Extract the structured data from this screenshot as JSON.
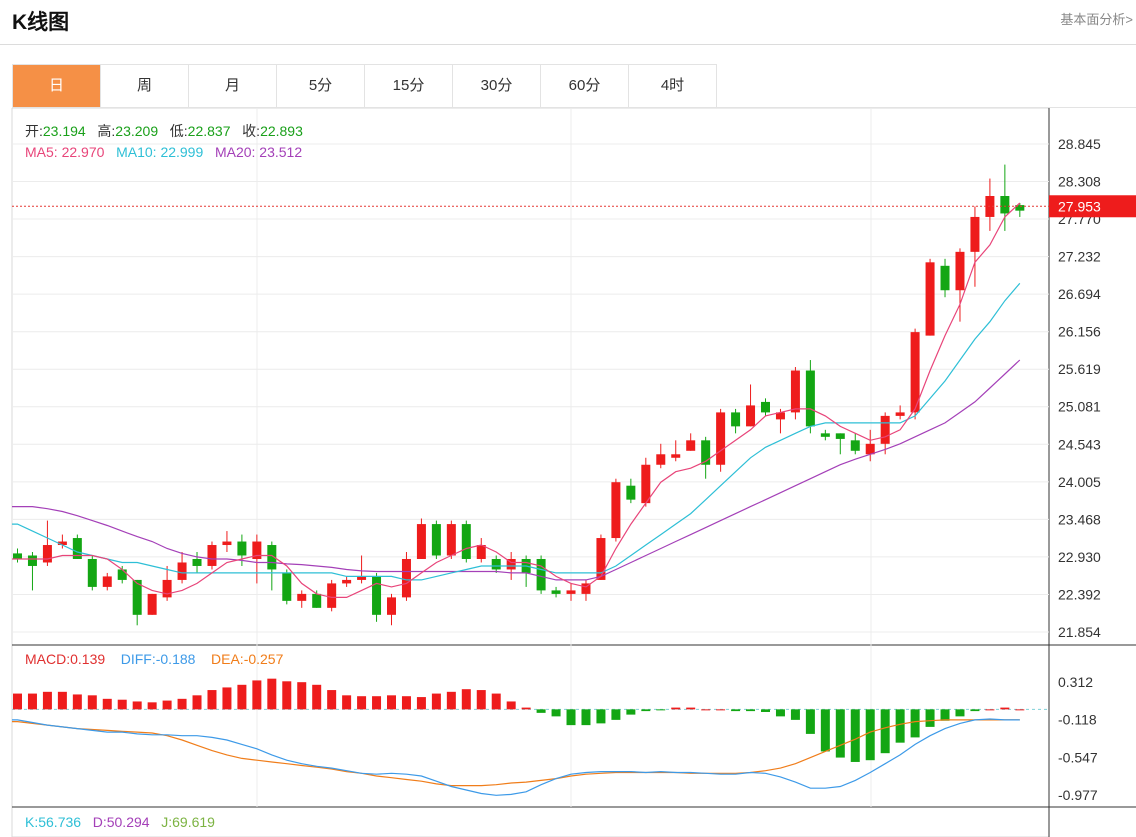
{
  "header": {
    "title": "K线图",
    "more_link": "基本面分析>"
  },
  "tabs": [
    {
      "label": "日",
      "active": true
    },
    {
      "label": "周",
      "active": false
    },
    {
      "label": "月",
      "active": false
    },
    {
      "label": "5分",
      "active": false
    },
    {
      "label": "15分",
      "active": false
    },
    {
      "label": "30分",
      "active": false
    },
    {
      "label": "60分",
      "active": false
    },
    {
      "label": "4时",
      "active": false
    }
  ],
  "ohlc_info": {
    "open_label": "开:",
    "open": "23.194",
    "high_label": "高:",
    "high": "23.209",
    "low_label": "低:",
    "low": "22.837",
    "close_label": "收:",
    "close": "22.893"
  },
  "ma_info": {
    "ma5_label": "MA5:",
    "ma5": "22.970",
    "ma10_label": "MA10:",
    "ma10": "22.999",
    "ma20_label": "MA20:",
    "ma20": "23.512"
  },
  "macd_info": {
    "macd_label": "MACD:",
    "macd": "0.139",
    "diff_label": "DIFF:",
    "diff": "-0.188",
    "dea_label": "DEA:",
    "dea": "-0.257"
  },
  "kdj_info": {
    "k_label": "K:",
    "k": "56.736",
    "d_label": "D:",
    "d": "50.294",
    "j_label": "J:",
    "j": "69.619"
  },
  "colors": {
    "up": "#ee1c1c",
    "down": "#13a613",
    "ma5": "#e8457a",
    "ma10": "#2ebfd6",
    "ma20": "#a440b8",
    "diff": "#3d9ae8",
    "dea": "#f07d1a",
    "accent": "#f59046"
  },
  "chart_data": [
    {
      "type": "candlestick",
      "ylim": [
        21.6,
        29.1
      ],
      "y_ticks": [
        "28.845",
        "28.308",
        "27.770",
        "27.232",
        "26.694",
        "26.156",
        "25.619",
        "25.081",
        "24.543",
        "24.005",
        "23.468",
        "22.930",
        "22.392",
        "21.854"
      ],
      "last_price": "27.953",
      "candles": [
        [
          22.98,
          22.9,
          23.05,
          22.85
        ],
        [
          22.95,
          22.8,
          23.0,
          22.45
        ],
        [
          22.85,
          23.1,
          23.45,
          22.8
        ],
        [
          23.1,
          23.15,
          23.25,
          23.05
        ],
        [
          23.2,
          22.9,
          23.25,
          22.9
        ],
        [
          22.9,
          22.5,
          22.95,
          22.45
        ],
        [
          22.5,
          22.65,
          22.7,
          22.45
        ],
        [
          22.75,
          22.6,
          22.8,
          22.55
        ],
        [
          22.6,
          22.1,
          22.6,
          21.95
        ],
        [
          22.1,
          22.4,
          22.4,
          22.1
        ],
        [
          22.35,
          22.6,
          22.8,
          22.3
        ],
        [
          22.6,
          22.85,
          23.0,
          22.55
        ],
        [
          22.9,
          22.8,
          23.0,
          22.7
        ],
        [
          22.8,
          23.1,
          23.15,
          22.75
        ],
        [
          23.1,
          23.15,
          23.3,
          23.0
        ],
        [
          23.15,
          22.95,
          23.25,
          22.8
        ],
        [
          22.9,
          23.15,
          23.25,
          22.55
        ],
        [
          23.1,
          22.75,
          23.15,
          22.45
        ],
        [
          22.7,
          22.3,
          22.75,
          22.25
        ],
        [
          22.3,
          22.4,
          22.45,
          22.2
        ],
        [
          22.4,
          22.2,
          22.45,
          22.2
        ],
        [
          22.2,
          22.55,
          22.6,
          22.15
        ],
        [
          22.55,
          22.6,
          22.65,
          22.5
        ],
        [
          22.6,
          22.65,
          22.95,
          22.55
        ],
        [
          22.65,
          22.1,
          22.7,
          22.0
        ],
        [
          22.1,
          22.35,
          22.4,
          21.95
        ],
        [
          22.35,
          22.9,
          23.0,
          22.3
        ],
        [
          22.9,
          23.4,
          23.48,
          22.9
        ],
        [
          23.4,
          22.95,
          23.45,
          22.9
        ],
        [
          22.95,
          23.4,
          23.45,
          22.9
        ],
        [
          23.4,
          22.9,
          23.45,
          22.85
        ],
        [
          22.9,
          23.1,
          23.2,
          22.85
        ],
        [
          22.9,
          22.75,
          22.95,
          22.7
        ],
        [
          22.75,
          22.9,
          23.0,
          22.6
        ],
        [
          22.9,
          22.7,
          22.95,
          22.5
        ],
        [
          22.9,
          22.45,
          22.95,
          22.4
        ],
        [
          22.45,
          22.4,
          22.5,
          22.35
        ],
        [
          22.4,
          22.45,
          22.55,
          22.3
        ],
        [
          22.4,
          22.55,
          22.6,
          22.3
        ],
        [
          22.6,
          23.2,
          23.25,
          22.6
        ],
        [
          23.2,
          24.0,
          24.05,
          23.15
        ],
        [
          23.95,
          23.75,
          24.05,
          23.7
        ],
        [
          23.7,
          24.25,
          24.35,
          23.65
        ],
        [
          24.25,
          24.4,
          24.55,
          24.2
        ],
        [
          24.35,
          24.4,
          24.6,
          24.3
        ],
        [
          24.45,
          24.6,
          24.7,
          24.45
        ],
        [
          24.6,
          24.25,
          24.65,
          24.05
        ],
        [
          24.25,
          25.0,
          25.05,
          24.15
        ],
        [
          25.0,
          24.8,
          25.05,
          24.7
        ],
        [
          24.8,
          25.1,
          25.4,
          24.8
        ],
        [
          25.15,
          25.0,
          25.2,
          24.95
        ],
        [
          24.9,
          25.0,
          25.05,
          24.7
        ],
        [
          25.0,
          25.6,
          25.65,
          24.9
        ],
        [
          25.6,
          24.8,
          25.75,
          24.7
        ],
        [
          24.7,
          24.65,
          24.75,
          24.6
        ],
        [
          24.7,
          24.62,
          24.7,
          24.4
        ],
        [
          24.6,
          24.45,
          24.7,
          24.4
        ],
        [
          24.4,
          24.55,
          24.75,
          24.3
        ],
        [
          24.55,
          24.95,
          25.0,
          24.4
        ],
        [
          24.95,
          25.0,
          25.1,
          24.9
        ],
        [
          25.0,
          26.15,
          26.2,
          24.9
        ],
        [
          26.1,
          27.15,
          27.2,
          26.1
        ],
        [
          27.1,
          26.75,
          27.2,
          26.65
        ],
        [
          26.75,
          27.3,
          27.35,
          26.3
        ],
        [
          27.3,
          27.8,
          27.95,
          26.8
        ],
        [
          27.8,
          28.1,
          28.35,
          27.6
        ],
        [
          28.1,
          27.85,
          28.55,
          27.6
        ],
        [
          27.97,
          27.89,
          28.0,
          27.8
        ]
      ],
      "ma5": [
        22.9,
        22.9,
        22.9,
        22.95,
        22.95,
        22.95,
        22.9,
        22.75,
        22.55,
        22.45,
        22.4,
        22.45,
        22.55,
        22.7,
        22.85,
        22.9,
        22.95,
        22.95,
        22.8,
        22.55,
        22.4,
        22.35,
        22.35,
        22.45,
        22.55,
        22.5,
        22.55,
        22.7,
        22.85,
        22.95,
        23.05,
        23.1,
        23.0,
        22.85,
        22.85,
        22.8,
        22.65,
        22.55,
        22.5,
        22.65,
        23.05,
        23.4,
        23.7,
        24.0,
        24.15,
        24.2,
        24.3,
        24.45,
        24.6,
        24.75,
        24.95,
        25.0,
        25.05,
        25.05,
        24.95,
        24.8,
        24.7,
        24.6,
        24.65,
        24.75,
        25.05,
        25.6,
        26.1,
        26.55,
        27.15,
        27.4,
        27.8,
        28.0
      ],
      "ma10": [
        23.4,
        23.3,
        23.2,
        23.1,
        23.0,
        22.95,
        22.9,
        22.85,
        22.85,
        22.8,
        22.75,
        22.7,
        22.7,
        22.7,
        22.7,
        22.7,
        22.7,
        22.7,
        22.7,
        22.7,
        22.7,
        22.7,
        22.65,
        22.65,
        22.65,
        22.65,
        22.6,
        22.6,
        22.65,
        22.7,
        22.75,
        22.8,
        22.8,
        22.8,
        22.8,
        22.75,
        22.7,
        22.7,
        22.7,
        22.7,
        22.8,
        22.95,
        23.1,
        23.25,
        23.4,
        23.55,
        23.75,
        23.95,
        24.15,
        24.35,
        24.5,
        24.6,
        24.7,
        24.8,
        24.85,
        24.85,
        24.85,
        24.85,
        24.85,
        24.85,
        24.95,
        25.2,
        25.45,
        25.75,
        26.05,
        26.3,
        26.6,
        26.85
      ],
      "ma20": [
        23.65,
        23.65,
        23.62,
        23.58,
        23.52,
        23.45,
        23.38,
        23.3,
        23.22,
        23.15,
        23.05,
        22.98,
        22.93,
        22.9,
        22.9,
        22.88,
        22.85,
        22.85,
        22.83,
        22.82,
        22.8,
        22.78,
        22.75,
        22.73,
        22.72,
        22.72,
        22.72,
        22.72,
        22.72,
        22.72,
        22.72,
        22.72,
        22.72,
        22.7,
        22.7,
        22.65,
        22.6,
        22.6,
        22.6,
        22.65,
        22.75,
        22.85,
        22.95,
        23.05,
        23.15,
        23.25,
        23.35,
        23.45,
        23.55,
        23.65,
        23.75,
        23.85,
        23.95,
        24.05,
        24.15,
        24.25,
        24.33,
        24.4,
        24.47,
        24.55,
        24.65,
        24.75,
        24.85,
        25.0,
        25.15,
        25.35,
        25.55,
        25.75
      ]
    },
    {
      "type": "bar",
      "name": "MACD",
      "ylim": [
        -1.2,
        0.55
      ],
      "y_ticks": [
        "0.312",
        "-0.118",
        "-0.547",
        "-0.977"
      ],
      "histogram": [
        0.18,
        0.18,
        0.2,
        0.2,
        0.17,
        0.16,
        0.12,
        0.11,
        0.09,
        0.08,
        0.1,
        0.12,
        0.16,
        0.22,
        0.25,
        0.28,
        0.33,
        0.35,
        0.32,
        0.31,
        0.28,
        0.22,
        0.16,
        0.15,
        0.15,
        0.16,
        0.15,
        0.14,
        0.18,
        0.2,
        0.23,
        0.22,
        0.18,
        0.09,
        0.02,
        -0.04,
        -0.08,
        -0.18,
        -0.18,
        -0.16,
        -0.12,
        -0.06,
        -0.02,
        -0.01,
        0.02,
        0.02,
        0.0,
        0.0,
        -0.02,
        -0.02,
        -0.03,
        -0.08,
        -0.12,
        -0.28,
        -0.48,
        -0.55,
        -0.6,
        -0.58,
        -0.5,
        -0.38,
        -0.32,
        -0.2,
        -0.13,
        -0.08,
        -0.02,
        0.0,
        0.02,
        0.0
      ],
      "diff": [
        -0.12,
        -0.15,
        -0.18,
        -0.2,
        -0.22,
        -0.24,
        -0.26,
        -0.26,
        -0.28,
        -0.29,
        -0.29,
        -0.3,
        -0.3,
        -0.32,
        -0.35,
        -0.4,
        -0.45,
        -0.52,
        -0.58,
        -0.62,
        -0.65,
        -0.67,
        -0.7,
        -0.73,
        -0.74,
        -0.73,
        -0.74,
        -0.76,
        -0.82,
        -0.88,
        -0.92,
        -0.96,
        -0.98,
        -0.97,
        -0.94,
        -0.86,
        -0.79,
        -0.74,
        -0.72,
        -0.71,
        -0.71,
        -0.71,
        -0.72,
        -0.71,
        -0.72,
        -0.72,
        -0.73,
        -0.74,
        -0.74,
        -0.72,
        -0.73,
        -0.77,
        -0.83,
        -0.9,
        -0.9,
        -0.88,
        -0.81,
        -0.72,
        -0.62,
        -0.52,
        -0.4,
        -0.3,
        -0.22,
        -0.16,
        -0.12,
        -0.11,
        -0.12,
        -0.12
      ],
      "dea": [
        -0.14,
        -0.16,
        -0.18,
        -0.2,
        -0.22,
        -0.23,
        -0.24,
        -0.25,
        -0.26,
        -0.27,
        -0.3,
        -0.35,
        -0.41,
        -0.47,
        -0.52,
        -0.56,
        -0.58,
        -0.6,
        -0.62,
        -0.64,
        -0.66,
        -0.68,
        -0.71,
        -0.73,
        -0.76,
        -0.78,
        -0.8,
        -0.82,
        -0.85,
        -0.87,
        -0.87,
        -0.87,
        -0.86,
        -0.84,
        -0.83,
        -0.81,
        -0.79,
        -0.76,
        -0.74,
        -0.73,
        -0.72,
        -0.72,
        -0.72,
        -0.72,
        -0.72,
        -0.73,
        -0.73,
        -0.73,
        -0.73,
        -0.72,
        -0.7,
        -0.67,
        -0.62,
        -0.55,
        -0.48,
        -0.41,
        -0.34,
        -0.26,
        -0.21,
        -0.17,
        -0.14,
        -0.13,
        -0.12,
        -0.12,
        -0.12,
        -0.12,
        -0.12,
        -0.12
      ]
    }
  ]
}
